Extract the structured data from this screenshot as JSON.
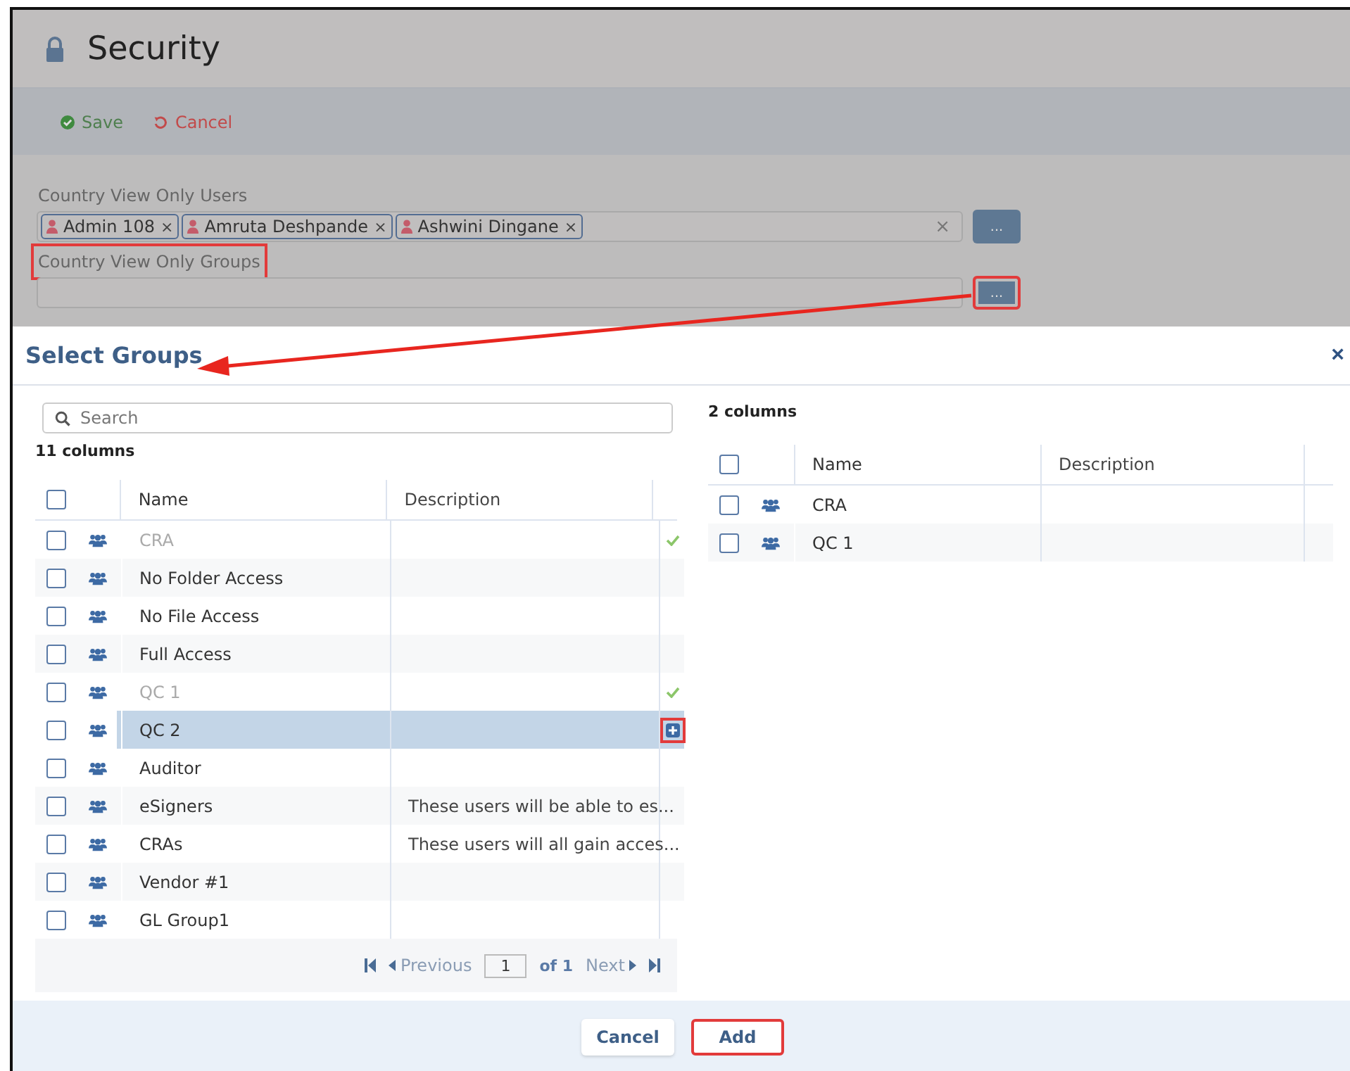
{
  "page": {
    "title": "Security"
  },
  "toolbar": [
    {
      "kind": "save",
      "label": "Save"
    },
    {
      "kind": "cancel",
      "label": "Cancel"
    }
  ],
  "form": {
    "users_field": {
      "label": "Country View Only Users",
      "tags": [
        {
          "label": "Admin 108",
          "remove": "×"
        },
        {
          "label": "Amruta Deshpande",
          "remove": "×"
        },
        {
          "label": "Ashwini Dingane",
          "remove": "×"
        }
      ],
      "clear": "×",
      "button": "..."
    },
    "groups_field": {
      "label": "Country View Only Groups",
      "annotated": true,
      "button": "...",
      "button_annotated": true
    }
  },
  "dialog": {
    "title": "Select Groups",
    "close": "×",
    "left": {
      "search_placeholder": "Search",
      "count": "11 columns",
      "all_checked": false,
      "columns": [
        "Name",
        "Description"
      ],
      "rows": [
        {
          "name": "CRA",
          "description": "",
          "checked": false,
          "added": true,
          "selected": false
        },
        {
          "name": "No Folder Access",
          "description": "",
          "checked": false,
          "added": false,
          "selected": false
        },
        {
          "name": "No File Access",
          "description": "",
          "checked": false,
          "added": false,
          "selected": false
        },
        {
          "name": "Full Access",
          "description": "",
          "checked": false,
          "added": false,
          "selected": false
        },
        {
          "name": "QC 1",
          "description": "",
          "checked": false,
          "added": true,
          "selected": false
        },
        {
          "name": "QC 2",
          "description": "",
          "checked": false,
          "added": false,
          "selected": true
        },
        {
          "name": "Auditor",
          "description": "",
          "checked": false,
          "added": false,
          "selected": false
        },
        {
          "name": "eSigners",
          "description": "These users will be able to es...",
          "checked": false,
          "added": false,
          "selected": false
        },
        {
          "name": "CRAs",
          "description": "These users will all gain acces...",
          "checked": false,
          "added": false,
          "selected": false
        },
        {
          "name": "Vendor #1",
          "description": "",
          "checked": false,
          "added": false,
          "selected": false
        },
        {
          "name": "GL Group1",
          "description": "",
          "checked": false,
          "added": false,
          "selected": false
        }
      ],
      "pager": {
        "previous": "Previous",
        "page": "1",
        "of": "of 1",
        "next": "Next"
      }
    },
    "right": {
      "count": "2 columns",
      "all_checked": false,
      "columns": [
        "Name",
        "Description"
      ],
      "rows": [
        {
          "name": "CRA",
          "description": "",
          "checked": false
        },
        {
          "name": "QC 1",
          "description": "",
          "checked": false
        }
      ]
    },
    "buttons": [
      {
        "label": "Cancel",
        "annotated": false
      },
      {
        "label": "Add",
        "annotated": true
      }
    ]
  }
}
